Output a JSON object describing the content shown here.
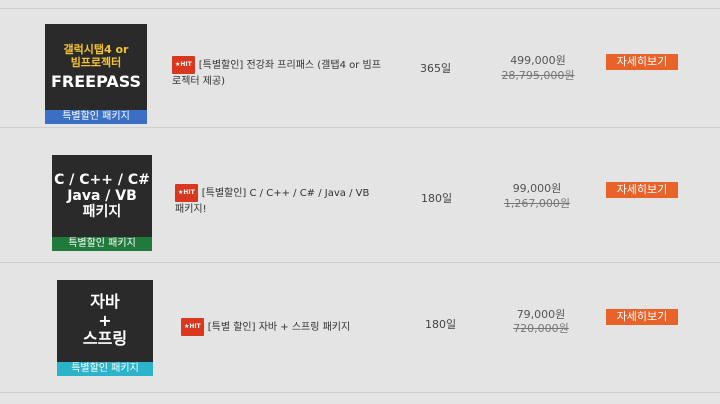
{
  "colors": {
    "accent_button": "#e8622a",
    "hit_badge": "#d9381e"
  },
  "hit_badge": "★HIT",
  "detail_label": "자세히보기",
  "packages": [
    {
      "thumb": {
        "line1": "갤럭시탭4 or",
        "line2": "빔프로젝터",
        "line3": "FREEPASS",
        "strip": "특별할인 패키지",
        "strip_color": "#3a6fc4"
      },
      "title": "[특별할인] 전강좌 프리패스 (갤탭4 or 빔프로젝터 제공)",
      "days": "365일",
      "price": "499,000원",
      "original_price": "28,795,000원"
    },
    {
      "thumb": {
        "line1": "C / C++ / C#",
        "line2": "Java / VB",
        "line3": "패키지",
        "strip": "특별할인 패키지",
        "strip_color": "#1f7a3c"
      },
      "title": "[특별할인] C / C++ / C# / Java / VB 패키지!",
      "days": "180일",
      "price": "99,000원",
      "original_price": "1,267,000원"
    },
    {
      "thumb": {
        "line1": "자바",
        "line2": "+",
        "line3": "스프링",
        "strip": "특별할인 패키지",
        "strip_color": "#2bb3c9"
      },
      "title": "[특별 할인] 자바 + 스프링 패키지",
      "days": "180일",
      "price": "79,000원",
      "original_price": "720,000원"
    }
  ]
}
